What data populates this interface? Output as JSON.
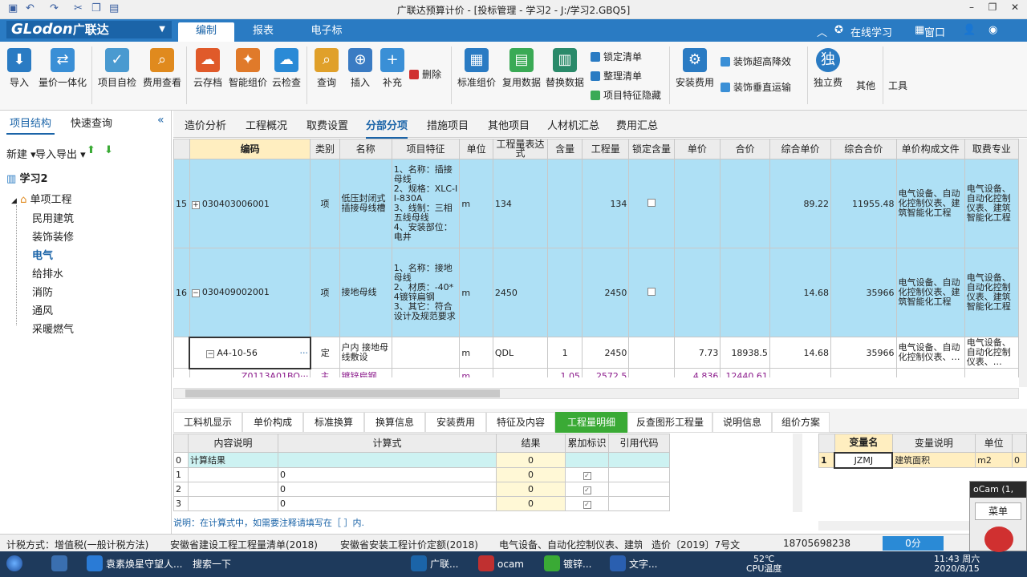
{
  "window": {
    "title": "广联达预算计价 - [投标管理 - 学习2 - J:/学习2.GBQ5]"
  },
  "menubar": {
    "logo": "GLodon",
    "logo_cn": "广联达",
    "tabs": [
      "编制",
      "报表",
      "电子标"
    ],
    "online": "在线学习",
    "window_menu": "窗口"
  },
  "ribbon": {
    "big": [
      {
        "label": "导入",
        "icon": "import-icon",
        "color": "#2a7bc3"
      },
      {
        "label": "量价一体化",
        "icon": "quantity-price-icon",
        "color": "#3a8fd6"
      },
      {
        "label": "项目自检",
        "icon": "self-check-icon",
        "color": "#4a9ad0"
      },
      {
        "label": "费用查看",
        "icon": "cost-view-icon",
        "color": "#e08a1e"
      },
      {
        "label": "云存档",
        "icon": "cloud-save-icon",
        "color": "#e05a2a"
      },
      {
        "label": "智能组价",
        "icon": "smart-price-icon",
        "color": "#e07a2a"
      },
      {
        "label": "云检查",
        "icon": "cloud-check-icon",
        "color": "#2a8ad6"
      },
      {
        "label": "查询",
        "icon": "query-icon",
        "color": "#e0a02a"
      },
      {
        "label": "插入",
        "icon": "insert-icon",
        "color": "#3a7bc3"
      },
      {
        "label": "补充",
        "icon": "supplement-icon",
        "color": "#3a8fd6"
      },
      {
        "label": "标准组价",
        "icon": "standard-price-icon",
        "color": "#2a7bc3"
      },
      {
        "label": "复用数据",
        "icon": "reuse-data-icon",
        "color": "#3aaa55"
      },
      {
        "label": "替换数据",
        "icon": "replace-data-icon",
        "color": "#2a8a6a"
      },
      {
        "label": "安装费用",
        "icon": "install-cost-icon",
        "color": "#2a7bc3"
      },
      {
        "label": "独立费",
        "icon": "independent-fee-icon",
        "color": "#2a7bc3"
      },
      {
        "label": "其他",
        "icon": "other-icon",
        "color": "#999999"
      },
      {
        "label": "工具",
        "icon": "tools-icon",
        "color": "#999999"
      }
    ],
    "small": {
      "delete": "删除",
      "lock": "锁定清单",
      "sort": "整理清单",
      "hide": "项目特征隐藏",
      "deco_reduce": "装饰超高降效",
      "deco_vertical": "装饰垂直运输"
    }
  },
  "left": {
    "tabs": [
      "项目结构",
      "快速查询"
    ],
    "new": "新建",
    "importexport": "导入导出",
    "project": "学习2",
    "unit": "单项工程",
    "items": [
      "民用建筑",
      "装饰装修",
      "电气",
      "给排水",
      "消防",
      "通风",
      "采暖燃气"
    ],
    "active_item": "电气"
  },
  "tabs2": [
    "造价分析",
    "工程概况",
    "取费设置",
    "分部分项",
    "措施项目",
    "其他项目",
    "人材机汇总",
    "费用汇总"
  ],
  "grid": {
    "headers": [
      "编码",
      "类别",
      "名称",
      "项目特征",
      "单位",
      "工程量表达式",
      "含量",
      "工程量",
      "锁定含量",
      "单价",
      "合价",
      "综合单价",
      "综合合价",
      "单价构成文件",
      "取费专业"
    ],
    "rows": [
      {
        "no": "15",
        "code": "030403006001",
        "type": "项",
        "name": "低压封闭式插接母线槽",
        "feature": "1、名称：插接母线\n2、规格：XLC-II-830A\n3、线制：三相五线母线\n4、安装部位：电井",
        "unit": "m",
        "expr": "134",
        "content": "",
        "qty": "134",
        "unitprice": "",
        "total": "",
        "comp_price": "89.22",
        "comp_total": "11955.48",
        "file": "电气设备、自动化控制仪表、建筑智能化工程",
        "prof": "电气设备、自动化控制仪表、建筑智能化工程"
      },
      {
        "no": "16",
        "code": "030409002001",
        "type": "项",
        "name": "接地母线",
        "feature": "1、名称：接地母线\n2、材质：-40*4镀锌扁钢\n3、其它：符合设计及规范要求",
        "unit": "m",
        "expr": "2450",
        "content": "",
        "qty": "2450",
        "unitprice": "",
        "total": "",
        "comp_price": "14.68",
        "comp_total": "35966",
        "file": "电气设备、自动化控制仪表、建筑智能化工程",
        "prof": "电气设备、自动化控制仪表、建筑智能化工程"
      }
    ],
    "sub": {
      "code": "A4-10-56",
      "more": "···",
      "type": "定",
      "name": "户内 接地母线敷设",
      "unit": "m",
      "expr": "QDL",
      "content": "1",
      "qty": "2450",
      "unitprice": "7.73",
      "total": "18938.5",
      "comp_price": "14.68",
      "comp_total": "35966",
      "file": "电气设备、自动化控制仪表、…",
      "prof": "电气设备、自动化控制仪表、…"
    },
    "mat": {
      "code": "Z0113A01BO···",
      "type": "主",
      "name": "镀锌扁钢",
      "unit": "m",
      "content": "1.05",
      "qty": "2572.5",
      "unitprice": "4.836",
      "total": "12440.61"
    }
  },
  "bottomtabs": [
    "工料机显示",
    "单价构成",
    "标准换算",
    "换算信息",
    "安装费用",
    "特征及内容",
    "工程量明细",
    "反查图形工程量",
    "说明信息",
    "组价方案"
  ],
  "calc": {
    "headers": [
      "内容说明",
      "计算式",
      "结果",
      "累加标识",
      "引用代码"
    ],
    "rows": [
      {
        "idx": "0",
        "desc": "计算结果",
        "expr": "",
        "result": "0",
        "checked": false
      },
      {
        "idx": "1",
        "desc": "",
        "expr": "0",
        "result": "0",
        "checked": true
      },
      {
        "idx": "2",
        "desc": "",
        "expr": "0",
        "result": "0",
        "checked": true
      },
      {
        "idx": "3",
        "desc": "",
        "expr": "0",
        "result": "0",
        "checked": true
      }
    ]
  },
  "vars": {
    "headers": [
      "变量名",
      "变量说明",
      "单位"
    ],
    "row": {
      "idx": "1",
      "name": "JZMJ",
      "desc": "建筑面积",
      "unit": "m2",
      "val": "0"
    }
  },
  "hint": "说明：在计算式中，如需要注释请填写在［ ］内.",
  "status": {
    "tax": "计税方式：增值税(一般计税方法)",
    "list": "安徽省建设工程工程量清单(2018)",
    "quota": "安徽省安装工程计价定额(2018)",
    "prof": "电气设备、自动化控制仪表、建筑",
    "doc": "造价〔2019〕7号文",
    "phone": "18705698238",
    "score": "0分"
  },
  "taskbar": {
    "items": [
      "袁素焕星守望人...",
      "搜索一下",
      "广联...",
      "ocam",
      "镀锌...",
      "文字..."
    ],
    "temp": "52℃",
    "cpu": "CPU温度",
    "time": "11:43 周六",
    "date": "2020/8/15"
  },
  "ocam": {
    "title": "oCam (1,",
    "menu": "菜单"
  }
}
